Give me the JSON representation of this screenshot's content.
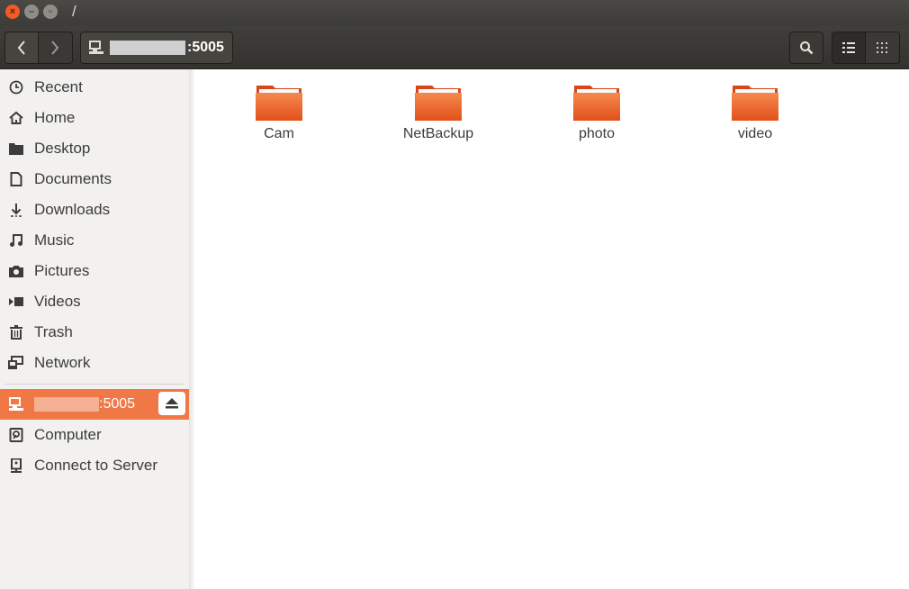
{
  "window": {
    "title": "/",
    "controls": [
      "close",
      "minimize",
      "maximize"
    ]
  },
  "header": {
    "back_icon": "chevron-left-icon",
    "forward_icon": "chevron-right-icon",
    "location_label": ":5005",
    "location_icon": "network-drive-icon",
    "search_icon": "search-icon",
    "view_list_icon": "list-view-icon",
    "view_grid_icon": "grid-view-icon"
  },
  "sidebar": {
    "items": [
      {
        "label": "Recent",
        "icon": "clock-icon"
      },
      {
        "label": "Home",
        "icon": "home-icon"
      },
      {
        "label": "Desktop",
        "icon": "folder-icon"
      },
      {
        "label": "Documents",
        "icon": "document-icon"
      },
      {
        "label": "Downloads",
        "icon": "download-icon"
      },
      {
        "label": "Music",
        "icon": "music-icon"
      },
      {
        "label": "Pictures",
        "icon": "camera-icon"
      },
      {
        "label": "Videos",
        "icon": "video-icon"
      },
      {
        "label": "Trash",
        "icon": "trash-icon"
      },
      {
        "label": "Network",
        "icon": "network-icon"
      }
    ],
    "devices": [
      {
        "label": ":5005",
        "icon": "network-drive-icon",
        "selected": true,
        "eject_icon": "eject-icon"
      },
      {
        "label": "Computer",
        "icon": "computer-icon"
      },
      {
        "label": "Connect to Server",
        "icon": "server-icon"
      }
    ]
  },
  "content": {
    "folders": [
      {
        "name": "Cam"
      },
      {
        "name": "NetBackup"
      },
      {
        "name": "photo"
      },
      {
        "name": "video"
      }
    ]
  },
  "colors": {
    "accent": "#f07746",
    "folder": "#e95420",
    "header_bg": "#3c3b37"
  }
}
